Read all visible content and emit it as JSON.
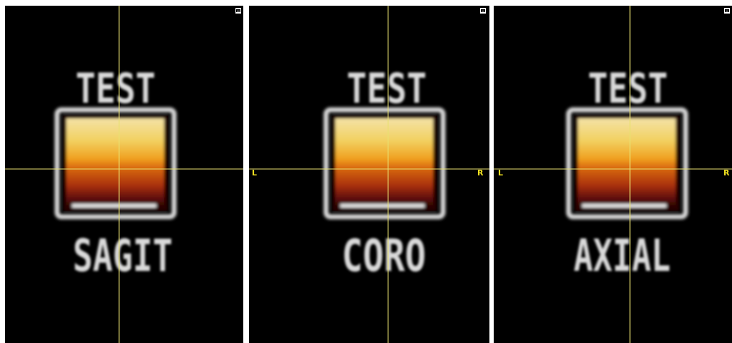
{
  "colors": {
    "background": "#000000",
    "crosshair": "#e8e070",
    "orientation_label": "#f0e020",
    "frame": "#d6d6d6",
    "frame_inner": "#6e1010"
  },
  "panels": [
    {
      "name": "sagittal",
      "top_label": "TEST",
      "bottom_label": "SAGIT",
      "left_label": "",
      "right_label": ""
    },
    {
      "name": "coronal",
      "top_label": "TEST",
      "bottom_label": "CORO",
      "left_label": "L",
      "right_label": "R"
    },
    {
      "name": "axial",
      "top_label": "TEST",
      "bottom_label": "AXIAL",
      "left_label": "L",
      "right_label": "R"
    }
  ],
  "icons": {
    "maximize": "maximize-icon"
  }
}
